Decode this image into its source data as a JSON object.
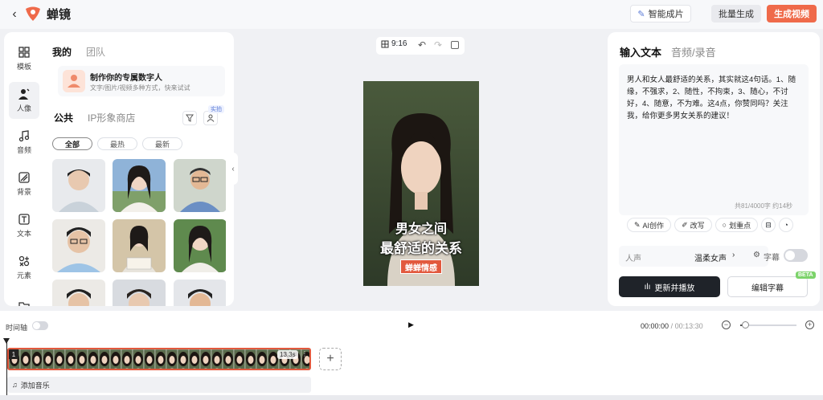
{
  "app": {
    "name": "蝉镜"
  },
  "topbar": {
    "smart_label": "智能成片",
    "batch_label": "批量生成",
    "generate_label": "生成视频"
  },
  "rail": [
    {
      "label": "模板",
      "icon": "template-icon"
    },
    {
      "label": "人像",
      "icon": "avatar-icon"
    },
    {
      "label": "音频",
      "icon": "music-icon"
    },
    {
      "label": "背景",
      "icon": "background-icon"
    },
    {
      "label": "文本",
      "icon": "text-icon"
    },
    {
      "label": "元素",
      "icon": "elements-icon"
    }
  ],
  "panel_tabs": {
    "mine": "我的",
    "team": "团队"
  },
  "promo": {
    "title": "制作你的专属数字人",
    "subtitle": "文字/图片/视频多种方式，快来试试"
  },
  "library_tabs": {
    "public": "公共",
    "ip_store": "IP形象商店",
    "badge": "实拍"
  },
  "filters": [
    "全部",
    "最热",
    "最新"
  ],
  "toolbar": {
    "ratio": "9:16"
  },
  "preview": {
    "caption_line1": "男女之间",
    "caption_line2": "最舒适的关系",
    "tag": "蝉蝉情感"
  },
  "right_tabs": {
    "text": "输入文本",
    "audio": "音频/录音"
  },
  "script": {
    "content": "男人和女人最舒适的关系，其实就这4句话。1、随缘，不强求，2、随性，不拘束，3、随心，不讨好，4、随意，不为难。这4点，你赞同吗？关注我，给你更多男女关系的建议！",
    "count": "共81/4000字 约14秒"
  },
  "actions": {
    "ai": "AI创作",
    "rewrite": "改写",
    "highlight": "划重点"
  },
  "voice": {
    "label": "人声",
    "value": "温柔女声",
    "subtitle_label": "字幕"
  },
  "buttons": {
    "update": "更新并播放",
    "edit_sub": "编辑字幕",
    "beta": "BETA"
  },
  "timeline": {
    "label": "时间轴",
    "current": "00:00:00",
    "total": "00:13:30",
    "clip_index": "1",
    "clip_duration": "13.3s",
    "music_label": "添加音乐",
    "zoom_level": 0.08
  }
}
